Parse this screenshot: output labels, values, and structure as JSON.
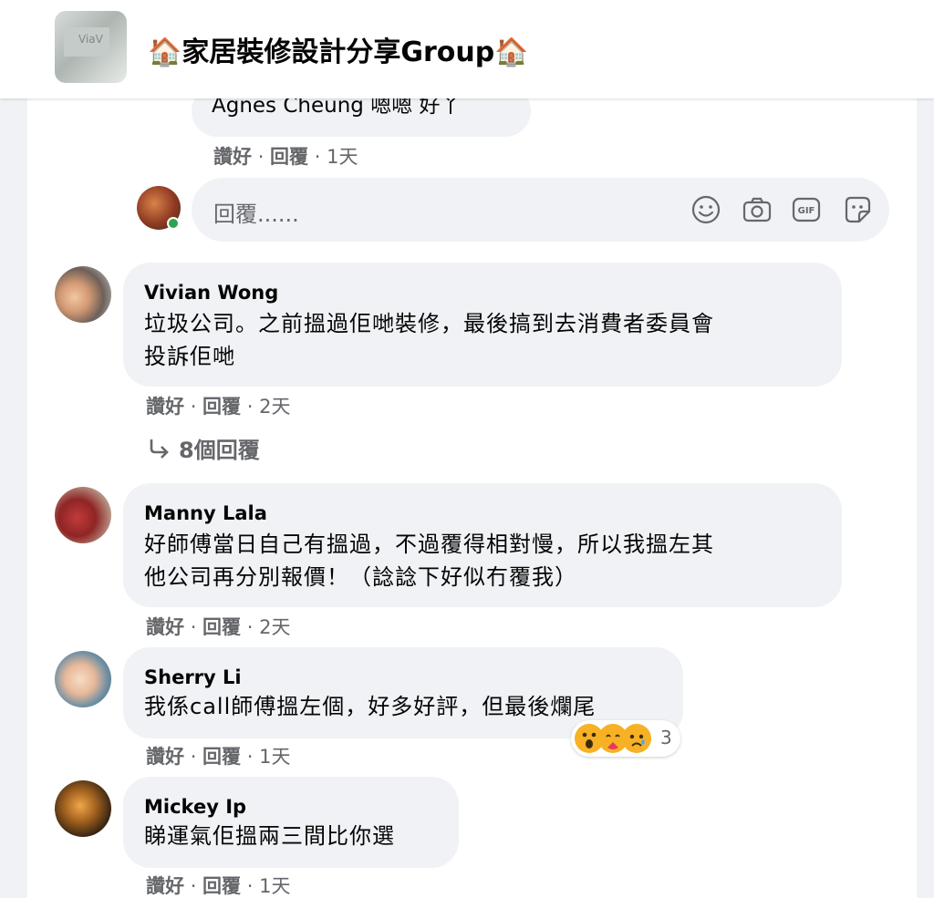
{
  "group": {
    "title": "🏠家居裝修設計分享Group🏠"
  },
  "top_comment": {
    "text": "Agnes Cheung 嗯嗯 好丫",
    "actions": {
      "like": "讚好",
      "reply": "回覆",
      "time": "1天"
    }
  },
  "reply_box": {
    "placeholder": "回覆......",
    "tools": [
      "emoji-icon",
      "camera-icon",
      "gif-icon",
      "sticker-icon"
    ]
  },
  "comments": [
    {
      "author": "Vivian Wong",
      "lines": [
        "垃圾公司。之前搵過佢哋裝修，最後搞到去消費者委員會",
        "投訴佢哋"
      ],
      "actions": {
        "like": "讚好",
        "reply": "回覆",
        "time": "2天"
      },
      "replies_label": "8個回覆"
    },
    {
      "author": "Manny Lala",
      "lines": [
        "好師傅當日自己有搵過，不過覆得相對慢，所以我搵左其",
        "他公司再分別報價！（諗諗下好似冇覆我）"
      ],
      "actions": {
        "like": "讚好",
        "reply": "回覆",
        "time": "2天"
      }
    },
    {
      "author": "Sherry Li",
      "lines": [
        "我係call師傅搵左個，好多好評，但最後爛尾"
      ],
      "actions": {
        "like": "讚好",
        "reply": "回覆",
        "time": "1天"
      },
      "reactions": {
        "icons": [
          "wow-icon",
          "care-icon",
          "sad-icon"
        ],
        "count": "3"
      }
    },
    {
      "author": "Mickey Ip",
      "lines": [
        "睇運氣佢搵兩三間比你選"
      ],
      "actions": {
        "like": "讚好",
        "reply": "回覆",
        "time": "1天"
      }
    }
  ],
  "colors": {
    "bubble": "#f0f2f5",
    "secondary_text": "#65676b",
    "online": "#31a24c"
  }
}
